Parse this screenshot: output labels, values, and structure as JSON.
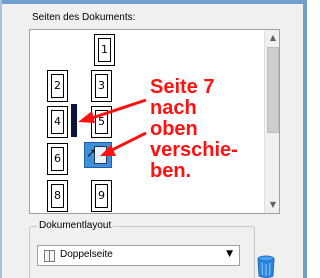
{
  "panel": {
    "pages_label": "Seiten des Dokuments:",
    "layout_label": "Dokumentlayout"
  },
  "pages": [
    {
      "number": "1"
    },
    {
      "number": "2"
    },
    {
      "number": "3"
    },
    {
      "number": "4"
    },
    {
      "number": "5"
    },
    {
      "number": "6"
    },
    {
      "number": "8"
    },
    {
      "number": "9"
    }
  ],
  "annotation": {
    "lines": [
      "Seite 7",
      "nach",
      "oben",
      "verschie-",
      "ben."
    ],
    "color": "#ff1111"
  },
  "scrollbar": {
    "up_icon": "scroll-up-arrow-icon",
    "down_icon": "scroll-down-arrow-icon"
  },
  "layout_select": {
    "value": "Doppelseite",
    "icon": "double-page-icon"
  },
  "colors": {
    "frame": "#6e9fcf",
    "panel_bg": "#f0f0f0",
    "annotation": "#ff1111",
    "drop_indicator": "#0c1240",
    "drag_ghost": "#3f8fd8"
  }
}
